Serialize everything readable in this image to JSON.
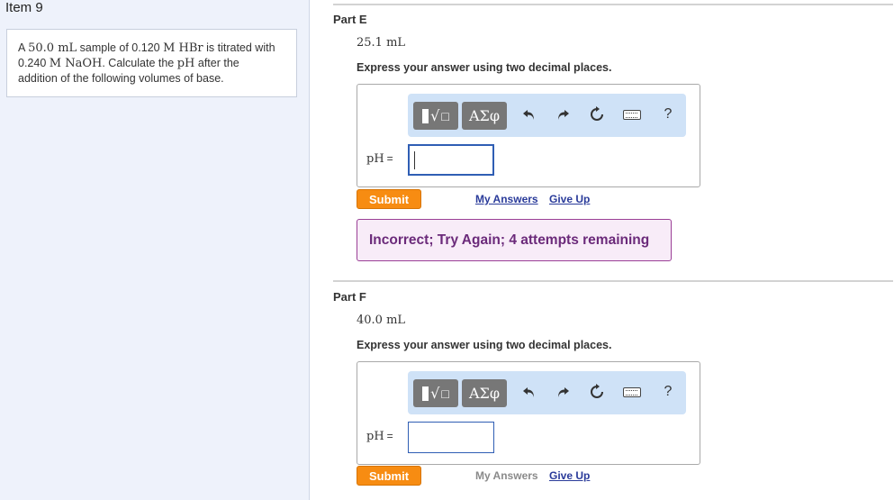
{
  "item": {
    "title": "Item 9"
  },
  "problem": {
    "t1": "A ",
    "m1": "50.0 mL",
    "t2": " sample of 0.120 ",
    "m2": "M HBr",
    "t3": " is titrated with",
    "t4": "0.240 ",
    "m3": "M NaOH",
    "t5": ". Calculate the ",
    "m4": "pH",
    "t6": " after the",
    "t7": "addition of the following volumes of base."
  },
  "parts": [
    {
      "label": "Part E",
      "volume": "25.1 mL",
      "instruction": "Express your answer using two decimal places.",
      "toolbar": {
        "greek_label": "ΑΣφ",
        "help_label": "?"
      },
      "answer_label": "pH",
      "answer_eq": "=",
      "answer_value": "",
      "submit_label": "Submit",
      "my_answers_label": "My Answers",
      "give_up_label": "Give Up",
      "feedback": "Incorrect; Try Again; 4 attempts remaining"
    },
    {
      "label": "Part F",
      "volume": "40.0 mL",
      "instruction": "Express your answer using two decimal places.",
      "toolbar": {
        "greek_label": "ΑΣφ",
        "help_label": "?"
      },
      "answer_label": "pH",
      "answer_eq": "=",
      "answer_value": "",
      "submit_label": "Submit",
      "my_answers_label": "My Answers",
      "give_up_label": "Give Up"
    }
  ],
  "colors": {
    "submit": "#f78c12",
    "link": "#2a3b9a",
    "feedback_border": "#9a3f96",
    "feedback_text": "#6b2a7a",
    "toolbar_bg": "#cfe2f7",
    "left_panel_bg": "#eef2fb"
  },
  "icons": [
    "math-template-icon",
    "greek-letters-icon",
    "undo-icon",
    "redo-icon",
    "reset-icon",
    "keyboard-icon",
    "help-icon"
  ]
}
